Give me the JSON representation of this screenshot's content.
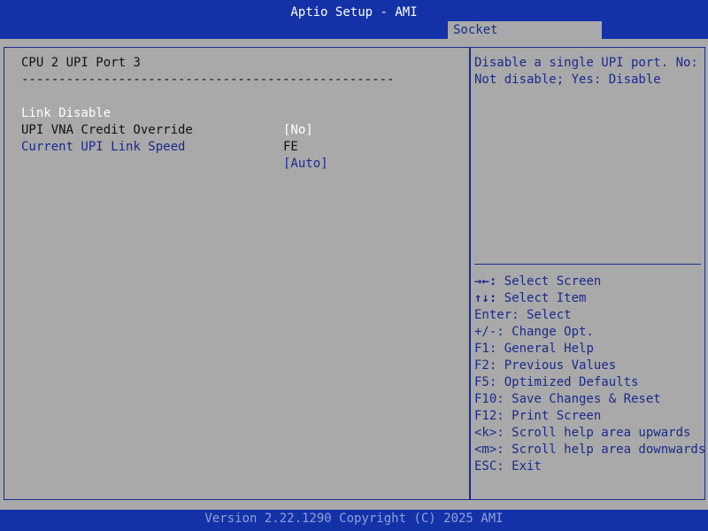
{
  "header": {
    "title": "Aptio Setup - AMI",
    "tab": "Socket Configuration"
  },
  "main": {
    "section_title": "CPU 2 UPI Port 3",
    "separator": "--------------------------------------------------",
    "items": [
      {
        "label": "Link Disable",
        "value": "[No]"
      },
      {
        "label": "UPI VNA Credit Override",
        "value": "FE"
      },
      {
        "label": "Current UPI Link Speed",
        "value": "[Auto]"
      }
    ]
  },
  "help": {
    "text": "Disable a single UPI port. No: Not disable; Yes: Disable"
  },
  "keys": [
    {
      "key": "→←:",
      "desc": " Select Screen"
    },
    {
      "key": "↑↓:",
      "desc": " Select Item"
    },
    {
      "key": "Enter:",
      "desc": " Select"
    },
    {
      "key": "+/-:",
      "desc": " Change Opt."
    },
    {
      "key": "F1:",
      "desc": " General Help"
    },
    {
      "key": "F2:",
      "desc": " Previous Values"
    },
    {
      "key": "F5:",
      "desc": " Optimized Defaults"
    },
    {
      "key": "F10:",
      "desc": " Save Changes & Reset"
    },
    {
      "key": "F12:",
      "desc": " Print Screen"
    },
    {
      "key": "<k>:",
      "desc": " Scroll help area upwards"
    },
    {
      "key": "<m>:",
      "desc": " Scroll help area downwards"
    },
    {
      "key": "ESC:",
      "desc": " Exit"
    }
  ],
  "footer": {
    "text": "Version 2.22.1290 Copyright (C) 2025 AMI"
  },
  "colors": {
    "background_blue": "#1432a8",
    "panel_gray": "#a9a9a9",
    "text_blue": "#1a2b8c",
    "highlight_white": "#ffffff"
  }
}
